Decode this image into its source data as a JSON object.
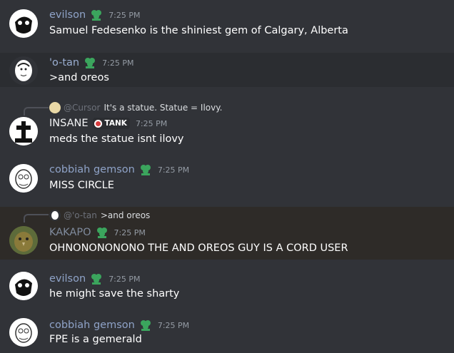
{
  "colors": {
    "background": "#313338",
    "highlight": "#2b2d31",
    "badge_green": "#3ba55d",
    "tag_red": "#d83c3e"
  },
  "messages": [
    {
      "user": "evilson",
      "time": "7:25 PM",
      "text": "Samuel Fedesenko is the shiniest gem of Calgary, Alberta"
    },
    {
      "user": "'o-tan",
      "time": "7:25 PM",
      "text": ">and oreos"
    },
    {
      "reply_user": "@Cursor",
      "reply_text": "It's a statue. Statue = Ilovy.",
      "user": "INSANE",
      "tag": "TANK",
      "time": "7:25 PM",
      "text": "meds the statue isnt ilovy"
    },
    {
      "user": "cobbiah gemson",
      "time": "7:25 PM",
      "text": "MISS CIRCLE"
    },
    {
      "reply_user": "@'o-tan",
      "reply_text": ">and oreos",
      "user": "KAKAPO",
      "time": "7:25 PM",
      "text": "OHNONONONONO THE AND OREOS GUY IS A CORD USER"
    },
    {
      "user": "evilson",
      "time": "7:25 PM",
      "text": "he might save the sharty"
    },
    {
      "user": "cobbiah gemson",
      "time": "7:25 PM",
      "text": "FPE is a gemerald"
    }
  ]
}
